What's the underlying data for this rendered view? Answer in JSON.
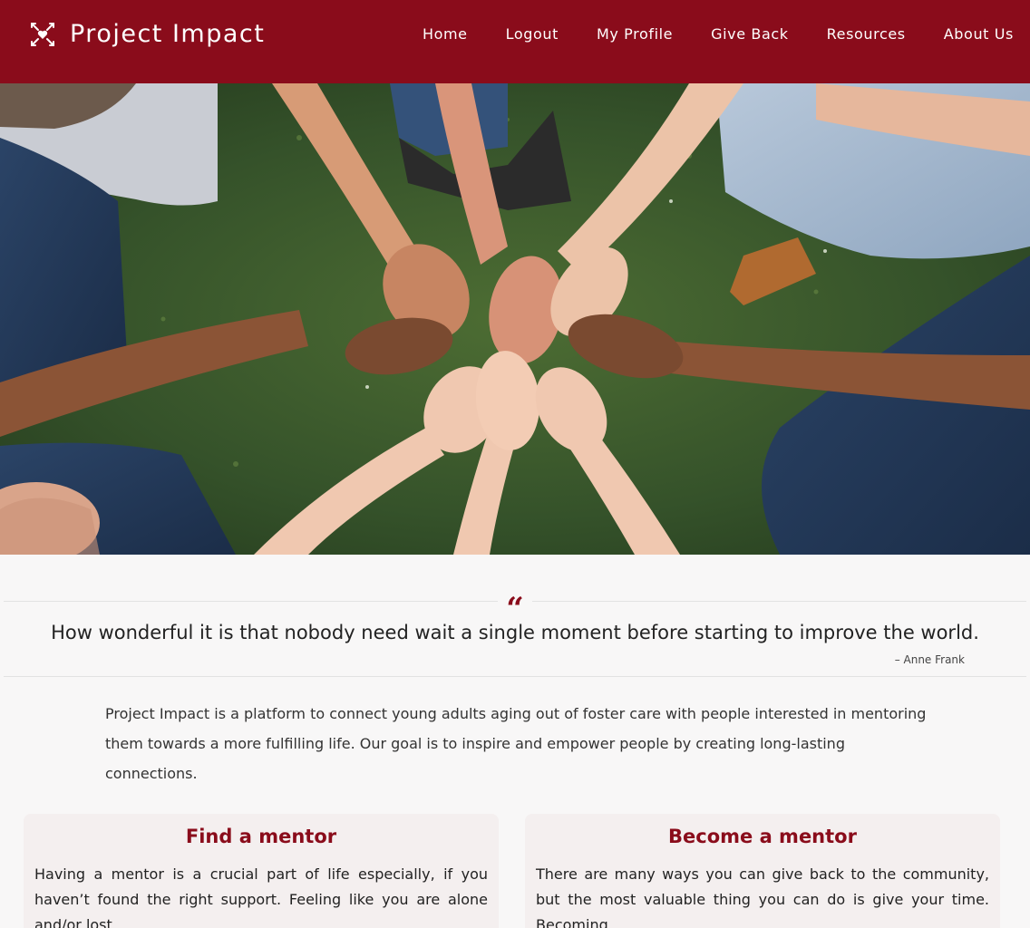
{
  "header": {
    "brand_name": "Project Impact",
    "brand_icon": "heart-arrows-icon",
    "nav": [
      {
        "label": "Home"
      },
      {
        "label": "Logout"
      },
      {
        "label": "My Profile"
      },
      {
        "label": "Give Back"
      },
      {
        "label": "Resources"
      },
      {
        "label": "About Us"
      }
    ]
  },
  "hero": {
    "image": "hands-stacked-on-grass-photo"
  },
  "quote": {
    "mark": "“",
    "text": "How wonderful it is that nobody need wait a single moment before starting to improve the world.",
    "author": "–   Anne Frank"
  },
  "intro": {
    "text": "Project Impact is a platform to connect young adults aging out of foster care with people interested in mentoring them towards a more fulfilling life. Our goal is to inspire and empower people by creating long-lasting connections."
  },
  "cards": [
    {
      "title": "Find a mentor",
      "body": "Having a mentor is a crucial part of life especially, if you haven’t found the right support. Feeling like you are alone and/or lost"
    },
    {
      "title": "Become a mentor",
      "body": "There are many ways you can give back to the community, but the most valuable thing you can do is give your time. Becoming"
    }
  ],
  "colors": {
    "brand": "#8a0c1b",
    "background": "#f8f7f7",
    "card_background": "#f4efef"
  }
}
